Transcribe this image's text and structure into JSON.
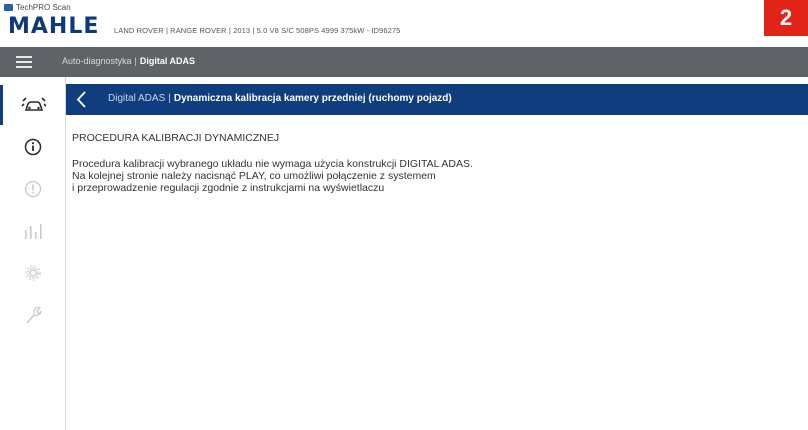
{
  "header": {
    "app_name": "TechPRO Scan",
    "brand": "MAHLE",
    "vehicle_info": "LAND ROVER | RANGE ROVER | 2013 | 5.0 V8 S/C 508PS 4999 375kW - ID96275",
    "figure_number": "2"
  },
  "nav": {
    "breadcrumb_parent": "Auto-diagnostyka",
    "breadcrumb_separator": "|",
    "breadcrumb_current": "Digital ADAS"
  },
  "sidebar": {
    "items": [
      {
        "icon": "car-sensor-icon",
        "active": true
      },
      {
        "icon": "info-icon",
        "active": false
      },
      {
        "icon": "alert-icon",
        "active": false
      },
      {
        "icon": "bar-chart-icon",
        "active": false
      },
      {
        "icon": "gear-icon",
        "active": false
      },
      {
        "icon": "wrench-icon",
        "active": false
      }
    ]
  },
  "page": {
    "section": "Digital ADAS",
    "separator": "|",
    "title": "Dynamiczna kalibracja kamery przedniej (ruchomy pojazd)"
  },
  "content": {
    "heading": "PROCEDURA KALIBRACJI DYNAMICZNEJ",
    "lines": [
      "Procedura kalibracji wybranego układu nie wymaga użycia konstrukcji DIGITAL ADAS.",
      "Na kolejnej stronie należy nacisnąć PLAY, co umożliwi połączenie z systemem",
      "i przeprowadzenie regulacji zgodnie z instrukcjami na wyświetlaczu"
    ]
  },
  "colors": {
    "brand_blue": "#103d7d",
    "nav_gray": "#5f6368",
    "badge_red": "#e2231a"
  }
}
